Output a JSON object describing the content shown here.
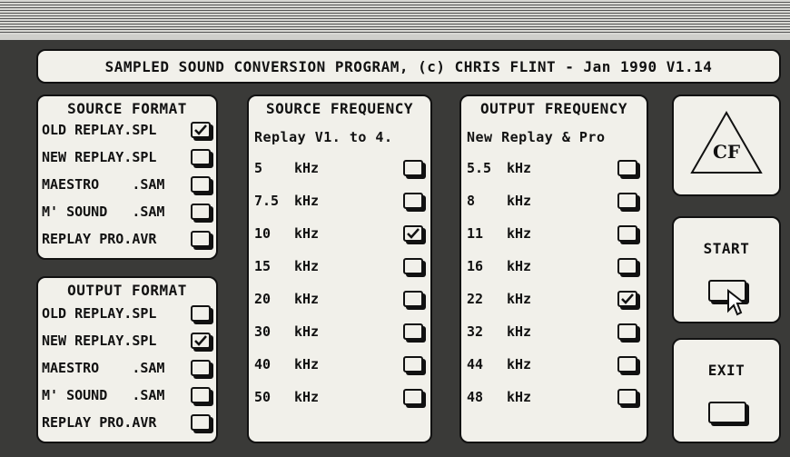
{
  "title": "SAMPLED SOUND CONVERSION PROGRAM, (c) CHRIS FLINT - Jan 1990 V1.14",
  "source_format": {
    "heading": "SOURCE FORMAT",
    "items": [
      {
        "label": "OLD REPLAY.SPL",
        "checked": true
      },
      {
        "label": "NEW REPLAY.SPL",
        "checked": false
      },
      {
        "label": "MAESTRO    .SAM",
        "checked": false
      },
      {
        "label": "M' SOUND   .SAM",
        "checked": false
      },
      {
        "label": "REPLAY PRO.AVR",
        "checked": false
      }
    ]
  },
  "output_format": {
    "heading": "OUTPUT FORMAT",
    "items": [
      {
        "label": "OLD REPLAY.SPL",
        "checked": false
      },
      {
        "label": "NEW REPLAY.SPL",
        "checked": true
      },
      {
        "label": "MAESTRO    .SAM",
        "checked": false
      },
      {
        "label": "M' SOUND   .SAM",
        "checked": false
      },
      {
        "label": "REPLAY PRO.AVR",
        "checked": false
      }
    ]
  },
  "source_frequency": {
    "heading": "SOURCE FREQUENCY",
    "subheading": "Replay V1. to 4.",
    "items": [
      {
        "value": "5",
        "unit": "kHz",
        "checked": false
      },
      {
        "value": "7.5",
        "unit": "kHz",
        "checked": false
      },
      {
        "value": "10",
        "unit": "kHz",
        "checked": true
      },
      {
        "value": "15",
        "unit": "kHz",
        "checked": false
      },
      {
        "value": "20",
        "unit": "kHz",
        "checked": false
      },
      {
        "value": "30",
        "unit": "kHz",
        "checked": false
      },
      {
        "value": "40",
        "unit": "kHz",
        "checked": false
      },
      {
        "value": "50",
        "unit": "kHz",
        "checked": false
      }
    ]
  },
  "output_frequency": {
    "heading": "OUTPUT FREQUENCY",
    "subheading": "New Replay & Pro",
    "items": [
      {
        "value": "5.5",
        "unit": "kHz",
        "checked": false
      },
      {
        "value": "8",
        "unit": "kHz",
        "checked": false
      },
      {
        "value": "11",
        "unit": "kHz",
        "checked": false
      },
      {
        "value": "16",
        "unit": "kHz",
        "checked": false
      },
      {
        "value": "22",
        "unit": "kHz",
        "checked": true
      },
      {
        "value": "32",
        "unit": "kHz",
        "checked": false
      },
      {
        "value": "44",
        "unit": "kHz",
        "checked": false
      },
      {
        "value": "48",
        "unit": "kHz",
        "checked": false
      }
    ]
  },
  "logo": {
    "glyph": "CF",
    "icon": "cf-logo-triangle-icon"
  },
  "buttons": {
    "start_label": "START",
    "exit_label": "EXIT"
  },
  "colors": {
    "panel": "#f1f0ea",
    "desktop": "#3a3a38",
    "ink": "#111111"
  }
}
